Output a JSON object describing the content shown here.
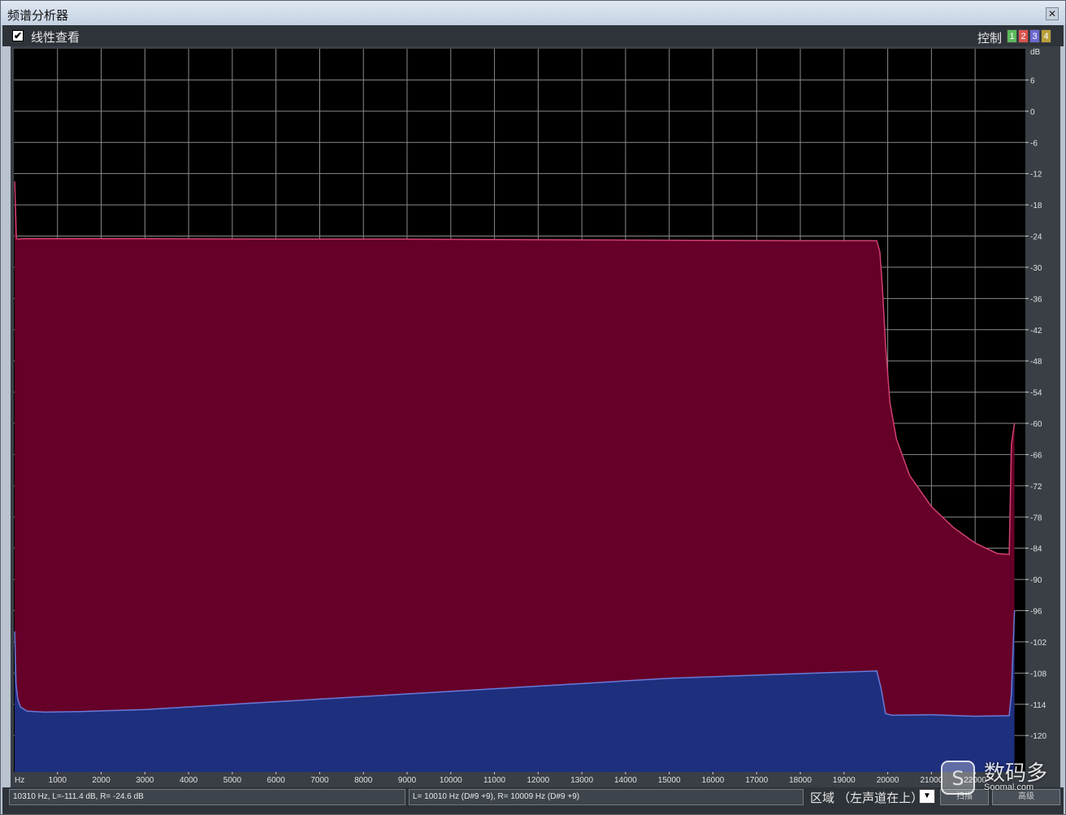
{
  "window": {
    "title": "频谱分析器",
    "close_glyph": "✕"
  },
  "toolbar": {
    "linear_view_label": "线性查看",
    "linear_view_checked": true,
    "control_label": "控制",
    "channels": [
      {
        "label": "1",
        "color": "#5cb85c"
      },
      {
        "label": "2",
        "color": "#d9534f"
      },
      {
        "label": "3",
        "color": "#6a6ad0"
      },
      {
        "label": "4",
        "color": "#b8a03a"
      }
    ]
  },
  "chart_data": {
    "type": "area",
    "xlabel": "Hz",
    "ylabel": "dB",
    "x_ticks": [
      1000,
      2000,
      3000,
      4000,
      5000,
      6000,
      7000,
      8000,
      9000,
      10000,
      11000,
      12000,
      13000,
      14000,
      15000,
      16000,
      17000,
      18000,
      19000,
      20000,
      21000,
      22000
    ],
    "x_tick_labels": [
      "1000",
      "2000",
      "3000",
      "4000",
      "5000",
      "6000",
      "7000",
      "8000",
      "9000",
      "10000",
      "11000",
      "12000",
      "13000",
      "14000",
      "15000",
      "16000",
      "17000",
      "18000",
      "19000",
      "20000",
      "21000",
      "22000"
    ],
    "y_ticks": [
      6,
      0,
      -6,
      -12,
      -18,
      -24,
      -30,
      -36,
      -42,
      -48,
      -54,
      -60,
      -66,
      -72,
      -78,
      -84,
      -90,
      -96,
      -102,
      -108,
      -114,
      -120
    ],
    "y_tick_labels": [
      "6",
      "0",
      "-6",
      "-12",
      "-18",
      "-24",
      "-30",
      "-36",
      "-42",
      "-48",
      "-54",
      "-60",
      "-66",
      "-72",
      "-78",
      "-84",
      "-90",
      "-96",
      "-102",
      "-108",
      "-114",
      "-120"
    ],
    "xlim": [
      0,
      23150
    ],
    "ylim": [
      -127,
      12
    ],
    "grid": true,
    "series": [
      {
        "color": "#660028",
        "line_color": "#d04070",
        "x": [
          20,
          60,
          120,
          200,
          1000,
          3000,
          6000,
          9000,
          12000,
          15000,
          18000,
          19200,
          19750,
          19820,
          19880,
          19950,
          20050,
          20200,
          20500,
          21000,
          21500,
          22000,
          22500,
          22780,
          22830,
          22900
        ],
        "y": [
          -13.5,
          -24.5,
          -24.6,
          -24.5,
          -24.5,
          -24.5,
          -24.6,
          -24.6,
          -24.7,
          -24.8,
          -24.9,
          -24.9,
          -24.9,
          -27,
          -34,
          -45,
          -56,
          -63,
          -70,
          -76,
          -80,
          -83,
          -85,
          -85.2,
          -64,
          -60
        ]
      },
      {
        "color": "#1e2f7e",
        "line_color": "#6a7ad8",
        "x": [
          20,
          50,
          90,
          150,
          300,
          700,
          1500,
          3000,
          5000,
          7000,
          9000,
          11000,
          13000,
          15000,
          17000,
          19000,
          19750,
          19850,
          19950,
          20100,
          21000,
          22000,
          22780,
          22830,
          22900
        ],
        "y": [
          -100,
          -110,
          -113,
          -114.5,
          -115.3,
          -115.5,
          -115.4,
          -115,
          -114,
          -113,
          -112,
          -111,
          -110,
          -109,
          -108.4,
          -107.8,
          -107.6,
          -111,
          -115.8,
          -116.1,
          -116,
          -116.3,
          -116.2,
          -112,
          -96
        ]
      }
    ]
  },
  "status": {
    "cursor_readout": "10310 Hz, L=-111.4 dB, R= -24.6 dB",
    "selection_readout": "L=  10010 Hz (D#9 +9), R=  10009 Hz (D#9 +9)",
    "region_label": "区域 （左声道在上）",
    "dropdown_glyph": "▼",
    "button1_label": "扫描",
    "button2_label": "高级"
  },
  "watermark": {
    "text": "数码多",
    "url": "Soomal.com"
  }
}
